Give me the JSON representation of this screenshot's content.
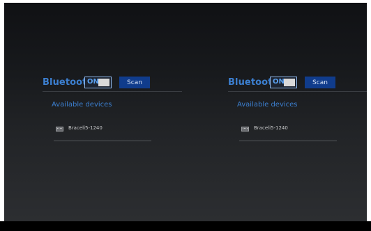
{
  "panels": [
    {
      "bluetooth_label": "Bluetooth",
      "toggle_label": "ON",
      "scan_label": "Scan",
      "section_title": "Available devices",
      "devices": [
        {
          "name": "Braceli5-1240",
          "icon": "keyboard-icon"
        }
      ]
    },
    {
      "bluetooth_label": "Bluetooth",
      "toggle_label": "ON",
      "scan_label": "Scan",
      "section_title": "Available devices",
      "devices": [
        {
          "name": "Braceli5-1240",
          "icon": "keyboard-icon"
        }
      ]
    }
  ],
  "colors": {
    "accent": "#3c7fd0",
    "button": "#103c8c",
    "background": "#1a1c1f"
  }
}
